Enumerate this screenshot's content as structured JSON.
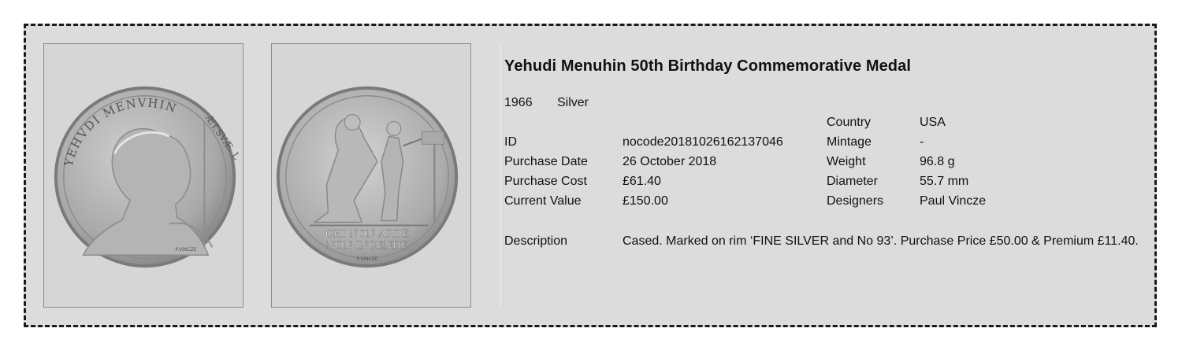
{
  "medal": {
    "title": "Yehudi Menuhin 50th Birthday Commemorative Medal",
    "year": "1966",
    "metal": "Silver"
  },
  "details": {
    "id_label": "ID",
    "id_value": "nocode20181026162137046",
    "purchase_date_label": "Purchase Date",
    "purchase_date_value": "26 October 2018",
    "purchase_cost_label": "Purchase Cost",
    "purchase_cost_value": "£61.40",
    "current_value_label": "Current Value",
    "current_value_value": "£150.00"
  },
  "specs": {
    "country_label": "Country",
    "country_value": "USA",
    "mintage_label": "Mintage",
    "mintage_value": "-",
    "weight_label": "Weight",
    "weight_value": "96.8 g",
    "diameter_label": "Diameter",
    "diameter_value": "55.7 mm",
    "designers_label": "Designers",
    "designers_value": "Paul Vincze"
  },
  "description": {
    "label": "Description",
    "text": "Cased.  Marked on rim ‘FINE SILVER and No 93’.  Purchase Price £50.00 & Premium £11.40."
  },
  "images": {
    "obverse_legend_left": "YEHVDI MENVHIN",
    "obverse_legend_right": "ÆT.SVÆ. L",
    "obverse_signature": "P.VINCZE",
    "reverse_motto_line1": "CHI NON ARDE",
    "reverse_motto_line2": "NON INCENDE",
    "reverse_signature": "P.VINCZE"
  }
}
